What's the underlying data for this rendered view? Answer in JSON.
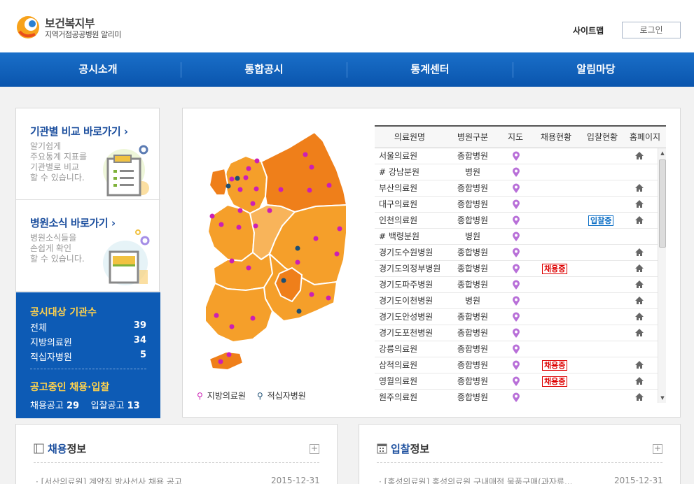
{
  "header": {
    "org": "보건복지부",
    "subtitle": "지역거점공공병원 알리미",
    "sitemap": "사이트맵",
    "login": "로그인"
  },
  "nav": [
    {
      "label": "공시소개"
    },
    {
      "label": "통합공시"
    },
    {
      "label": "통계센터"
    },
    {
      "label": "알림마당"
    }
  ],
  "quicklinks": [
    {
      "title": "기관별 비교 바로가기",
      "desc": [
        "알기쉽게",
        "주요통계 지표를",
        "기관별로 비교",
        "할 수 있습니다."
      ]
    },
    {
      "title": "병원소식 바로가기",
      "desc": [
        "병원소식들을",
        "손쉽게 확인",
        "할 수 있습니다."
      ]
    }
  ],
  "stats": {
    "title": "공시대상 기관수",
    "rows": [
      {
        "label": "전체",
        "value": "39"
      },
      {
        "label": "지방의료원",
        "value": "34"
      },
      {
        "label": "적십자병원",
        "value": "5"
      }
    ],
    "title2": "공고중인 채용·입찰",
    "hire_label": "채용공고",
    "hire_count": "29",
    "bid_label": "입찰공고",
    "bid_count": "13"
  },
  "legend": {
    "local": "지방의료원",
    "redcross": "적십자병원"
  },
  "colors": {
    "nav": "#0a55ad",
    "pin_local": "#cc1fb4",
    "pin_redcross": "#1d4f73",
    "map_dark": "#ef7f1a",
    "map_mid": "#f59f2a",
    "map_light": "#f8b45a"
  },
  "table": {
    "headers": [
      "의료원명",
      "병원구분",
      "지도",
      "채용현황",
      "입찰현황",
      "홈페이지"
    ],
    "rows": [
      {
        "name": "서울의료원",
        "type": "종합병원",
        "hire": "",
        "bid": "",
        "home": true
      },
      {
        "name": "# 강남분원",
        "type": "병원",
        "hire": "",
        "bid": "",
        "home": false
      },
      {
        "name": "부산의료원",
        "type": "종합병원",
        "hire": "",
        "bid": "",
        "home": true
      },
      {
        "name": "대구의료원",
        "type": "종합병원",
        "hire": "",
        "bid": "",
        "home": true
      },
      {
        "name": "인천의료원",
        "type": "종합병원",
        "hire": "",
        "bid": "입찰중",
        "home": true
      },
      {
        "name": "# 백령분원",
        "type": "병원",
        "hire": "",
        "bid": "",
        "home": false
      },
      {
        "name": "경기도수원병원",
        "type": "종합병원",
        "hire": "",
        "bid": "",
        "home": true
      },
      {
        "name": "경기도의정부병원",
        "type": "종합병원",
        "hire": "채용중",
        "bid": "",
        "home": true
      },
      {
        "name": "경기도파주병원",
        "type": "종합병원",
        "hire": "",
        "bid": "",
        "home": true
      },
      {
        "name": "경기도이천병원",
        "type": "병원",
        "hire": "",
        "bid": "",
        "home": true
      },
      {
        "name": "경기도안성병원",
        "type": "종합병원",
        "hire": "",
        "bid": "",
        "home": true
      },
      {
        "name": "경기도포천병원",
        "type": "종합병원",
        "hire": "",
        "bid": "",
        "home": true
      },
      {
        "name": "강릉의료원",
        "type": "종합병원",
        "hire": "",
        "bid": "",
        "home": false
      },
      {
        "name": "삼척의료원",
        "type": "종합병원",
        "hire": "채용중",
        "bid": "",
        "home": true
      },
      {
        "name": "영월의료원",
        "type": "종합병원",
        "hire": "채용중",
        "bid": "",
        "home": true
      },
      {
        "name": "원주의료원",
        "type": "종합병원",
        "hire": "",
        "bid": "",
        "home": true
      }
    ]
  },
  "panels": {
    "hire": {
      "title_hl": "채용",
      "title_rest": "정보",
      "item": "[서산의료원] 계약직 방사선사 채용 공고",
      "date": "2015-12-31"
    },
    "bid": {
      "title_hl": "입찰",
      "title_rest": "정보",
      "item": "[홍성의료원] 홍성의료원 구내매점 물품구매(과자류...",
      "date": "2015-12-31"
    }
  }
}
